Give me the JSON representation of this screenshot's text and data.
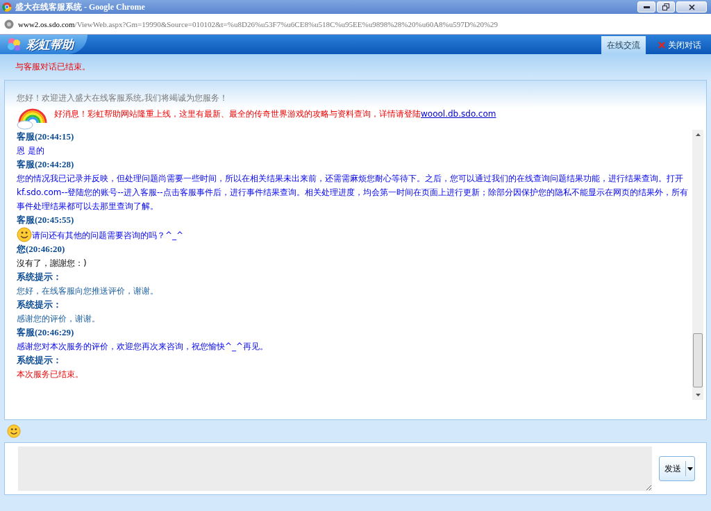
{
  "window": {
    "title": "盛大在线客服系统 - Google Chrome"
  },
  "address_bar": {
    "host": "www2.os.sdo.com",
    "path": "/ViewWeb.aspx?Gm=19990&Source=010102&t=%u8D26%u53F7%u6CE8%u518C%u95EE%u9898%28%20%u60A8%u597D%20%29"
  },
  "header": {
    "logo": "彩虹帮助",
    "tabs": [
      {
        "label": "在线交流",
        "selected": true
      }
    ],
    "close_button": "关闭对话"
  },
  "notice": "与客服对话已结束。",
  "welcome": "您好！欢迎进入盛大在线客服系统,我们将竭诚为您服务！",
  "promo": {
    "text": "好消息！彩虹帮助网站隆重上线，这里有最新、最全的传奇世界游戏的攻略与资料查询，详情请登陆",
    "link": "woool.db.sdo.com"
  },
  "messages": [
    {
      "kind": "sender",
      "text": "客服(20:44:15)"
    },
    {
      "kind": "agent",
      "text": "恩 是的"
    },
    {
      "kind": "sender",
      "text": "客服(20:44:28)"
    },
    {
      "kind": "agent",
      "text": "您的情况我已记录并反映，但处理问题尚需要一些时间，所以在相关结果未出来前，还需需麻烦您耐心等待下。之后，您可以通过我们的在线查询问题结果功能，进行结果查询。打开kf.sdo.com--登陆您的账号--进入客服--点击客服事件后，进行事件结果查询。相关处理进度，均会第一时间在页面上进行更新；除部分因保护您的隐私不能显示在网页的结果外，所有事件处理结果都可以去那里查询了解。"
    },
    {
      "kind": "sender",
      "text": "客服(20:45:55)"
    },
    {
      "kind": "agent",
      "smiley": true,
      "text": "请问还有其他的问题需要咨询的吗？^_^"
    },
    {
      "kind": "sender",
      "text": "您(20:46:20)"
    },
    {
      "kind": "user",
      "text": "沒有了，謝謝您：)"
    },
    {
      "kind": "sender",
      "text": "系统提示："
    },
    {
      "kind": "system",
      "text": "您好，在线客服向您推送评价，谢谢。"
    },
    {
      "kind": "sender",
      "text": "系统提示："
    },
    {
      "kind": "system",
      "text": "感谢您的评价，谢谢。"
    },
    {
      "kind": "sender",
      "text": "客服(20:46:29)"
    },
    {
      "kind": "agent",
      "text": "感谢您对本次服务的评价，欢迎您再次来咨询，祝您愉快^_^再见。"
    },
    {
      "kind": "sender",
      "text": "系统提示："
    },
    {
      "kind": "end",
      "text": "本次服务已结束。"
    }
  ],
  "send_button": "发送"
}
